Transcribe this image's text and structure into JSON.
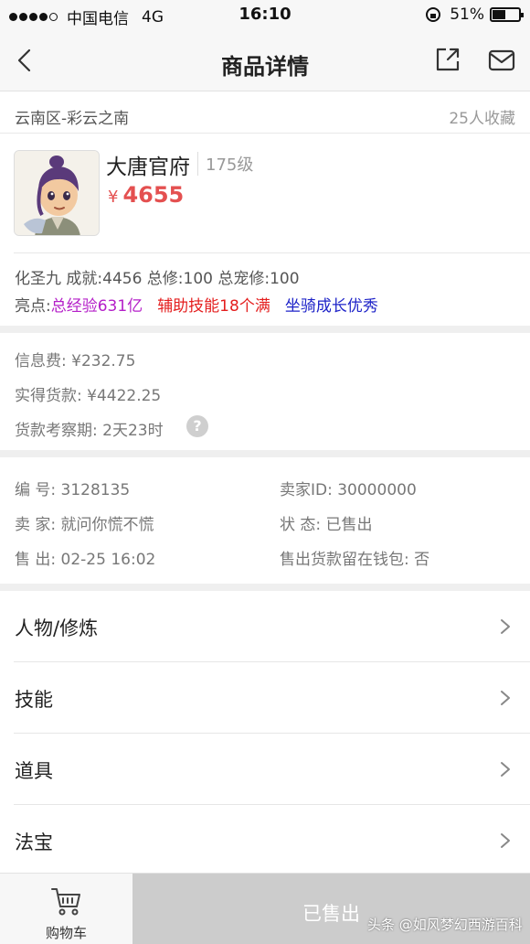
{
  "status_bar": {
    "carrier": "中国电信",
    "network": "4G",
    "time": "16:10",
    "battery": "51%",
    "battery_level": 0.51
  },
  "nav": {
    "title": "商品详情",
    "back_icon": "chevron-left-icon",
    "share_icon": "share-external-icon",
    "message_icon": "mail-icon"
  },
  "listing": {
    "region": "云南区-彩云之南",
    "favorites": "25人收藏",
    "character_name": "大唐官府",
    "level": "175级",
    "currency": "¥",
    "price": "4655",
    "stats": "化圣九 成就:4456 总修:100 总宠修:100",
    "highlights_label": "亮点:",
    "highlights": [
      "总经验631亿",
      "辅助技能18个满",
      "坐骑成长优秀"
    ]
  },
  "fees": {
    "info_fee": "信息费: ¥232.75",
    "payout": "实得货款: ¥4422.25",
    "review_period": "货款考察期: 2天23时",
    "help_icon": "question-icon",
    "help_glyph": "?"
  },
  "details": {
    "id": "编 号:  3128135",
    "seller_id": "卖家ID:  30000000",
    "seller": "卖 家:  就问你慌不慌",
    "status": "状 态:  已售出",
    "sold_at": "售 出:  02-25 16:02",
    "keep_in_wallet": "售出货款留在钱包:  否"
  },
  "menu": [
    {
      "label": "人物/修炼"
    },
    {
      "label": "技能"
    },
    {
      "label": "道具"
    },
    {
      "label": "法宝"
    }
  ],
  "bottom": {
    "cart_label": "购物车",
    "cart_icon": "shopping-cart-icon",
    "sold_label": "已售出"
  },
  "watermark": "头条 @如风梦幻西游百科",
  "colors": {
    "price": "#e45050",
    "highlight_1": "#b41ec8",
    "highlight_2": "#e41e1e",
    "highlight_3": "#1e23c8",
    "sold_button": "#cccccc"
  }
}
